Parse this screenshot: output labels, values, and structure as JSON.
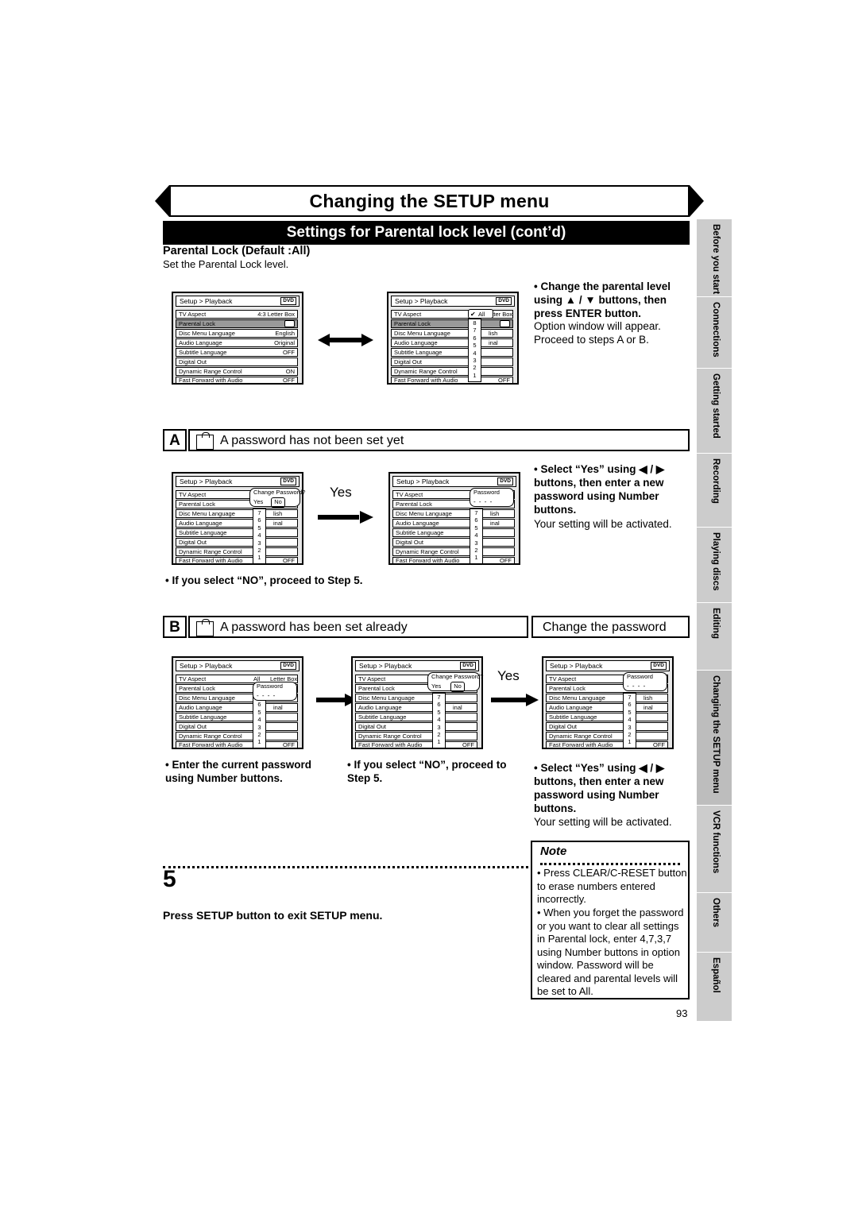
{
  "header": {
    "title": "Changing the SETUP menu",
    "subtitle": "Settings for Parental lock level (cont’d)",
    "section_heading": "Parental Lock (Default :All)",
    "section_sub": "Set the Parental Lock level."
  },
  "side_tabs": [
    {
      "label": "Before you start"
    },
    {
      "label": "Connections"
    },
    {
      "label": "Getting started"
    },
    {
      "label": "Recording"
    },
    {
      "label": "Playing discs"
    },
    {
      "label": "Editing"
    },
    {
      "label": "Changing the SETUP menu"
    },
    {
      "label": "VCR functions"
    },
    {
      "label": "Others"
    },
    {
      "label": "Español"
    }
  ],
  "osd": {
    "bar_title": "Setup > Playback",
    "dvd_badge": "DVD",
    "rows": [
      {
        "label": "TV Aspect",
        "value": "4:3 Letter Box"
      },
      {
        "label": "Parental Lock",
        "value": "All"
      },
      {
        "label": "Disc Menu Language",
        "value": "English"
      },
      {
        "label": "Audio Language",
        "value": "Original"
      },
      {
        "label": "Subtitle Language",
        "value": "OFF"
      },
      {
        "label": "Digital Out",
        "value": ""
      },
      {
        "label": "Dynamic Range Control",
        "value": "ON"
      },
      {
        "label": "Fast Forward with Audio",
        "value": "OFF"
      }
    ],
    "levels": [
      "8",
      "7",
      "6",
      "5",
      "4",
      "3",
      "2",
      "1"
    ],
    "levels_short": [
      "7",
      "6",
      "5",
      "4",
      "3",
      "2",
      "1"
    ],
    "all_check": "All",
    "popup_change_password": "Change Password?",
    "popup_yes": "Yes",
    "popup_no": "No",
    "popup_password": "Password",
    "popup_password_dashes": "- - - -",
    "partial_values": {
      "letterbox": "Letter Box",
      "english": "lish",
      "original": "inal",
      "off": "OFF"
    }
  },
  "step_top": {
    "bullet_bold": "• Change the parental level using ▲ / ▼ buttons, then press ENTER button.",
    "line1": "Option window will appear.",
    "line2": "Proceed to steps A or B."
  },
  "block_a": {
    "badge": "A",
    "title": "A password has not been set yet",
    "yes_label": "Yes",
    "bullet_bold": "• Select “Yes” using ◀ / ▶ buttons, then enter a new password using Number buttons.",
    "note": "Your setting will be activated.",
    "footnote_bold": "• If you select “NO”, proceed to Step",
    "footnote_num": "5."
  },
  "block_b": {
    "badge": "B",
    "title": "A password has been set already",
    "change_title": "Change the password",
    "yes_label": "Yes",
    "bullet1": "• Enter the current password using Number buttons.",
    "bullet2_bold": "• If you select “NO”, proceed to Step",
    "bullet2_num": "5.",
    "bullet3_bold": "• Select “Yes” using ◀ / ▶ buttons, then enter a new password using Number buttons.",
    "bullet3_note": "Your setting will be activated."
  },
  "step5": {
    "number": "5",
    "text_plain_1": "Press ",
    "text_bold_1": "SETUP",
    "text_plain_2": " button to exit ",
    "text_bold_2": "SETUP",
    "text_plain_3": " menu.",
    "full": "Press SETUP button to exit SETUP menu."
  },
  "note": {
    "label": "Note",
    "items": [
      "• Press CLEAR/C-RESET button to erase numbers entered incorrectly.",
      "• When you forget the password or you want to clear all settings in Parental lock, enter 4,7,3,7 using Number buttons in option window. Password will be cleared and parental levels will be set to All."
    ]
  },
  "page_number": "93"
}
